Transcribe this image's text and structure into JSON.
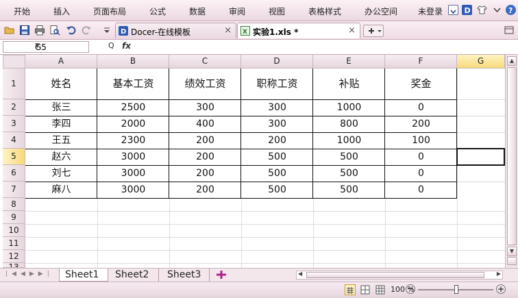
{
  "menu": {
    "items": [
      "开始",
      "插入",
      "页面布局",
      "公式",
      "数据",
      "审阅",
      "视图",
      "表格样式",
      "办公空间"
    ],
    "login": "未登录"
  },
  "tabs": [
    {
      "label": "Docer-在线模板",
      "active": false
    },
    {
      "label": "实验1.xls *",
      "active": true
    }
  ],
  "formula_bar": {
    "cell_ref": "G5",
    "fx_label": "fx",
    "content": ""
  },
  "columns": [
    "A",
    "B",
    "C",
    "D",
    "E",
    "F",
    "G"
  ],
  "selected_column": "G",
  "rows": [
    "1",
    "2",
    "3",
    "4",
    "5",
    "6",
    "7",
    "8",
    "9",
    "10",
    "11",
    "12",
    "13"
  ],
  "selected_row": "5",
  "table": {
    "header": [
      "姓名",
      "基本工资",
      "绩效工资",
      "职称工资",
      "补贴",
      "奖金"
    ],
    "data": [
      [
        "张三",
        "2500",
        "300",
        "300",
        "1000",
        "0"
      ],
      [
        "李四",
        "2000",
        "400",
        "300",
        "800",
        "200"
      ],
      [
        "王五",
        "2300",
        "200",
        "200",
        "1000",
        "100"
      ],
      [
        "赵六",
        "3000",
        "200",
        "500",
        "500",
        "0"
      ],
      [
        "刘七",
        "3000",
        "200",
        "500",
        "500",
        "0"
      ],
      [
        "麻八",
        "3000",
        "200",
        "500",
        "500",
        "0"
      ]
    ]
  },
  "sheets": [
    "Sheet1",
    "Sheet2",
    "Sheet3"
  ],
  "active_sheet": "Sheet1",
  "status": {
    "zoom": "100 %"
  },
  "colors": {
    "accent": "#e9d5de",
    "selected_header": "#f6d97a"
  }
}
